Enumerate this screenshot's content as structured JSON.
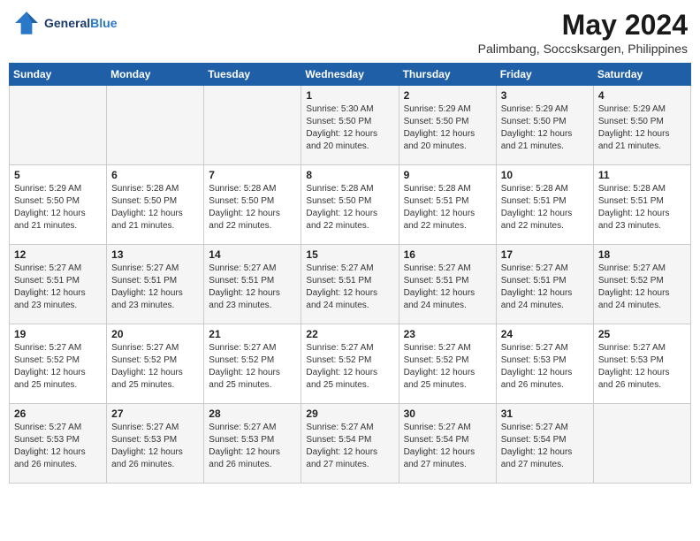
{
  "header": {
    "logo_line1": "General",
    "logo_line2": "Blue",
    "month_year": "May 2024",
    "location": "Palimbang, Soccsksargen, Philippines"
  },
  "days_of_week": [
    "Sunday",
    "Monday",
    "Tuesday",
    "Wednesday",
    "Thursday",
    "Friday",
    "Saturday"
  ],
  "weeks": [
    [
      {
        "day": "",
        "info": ""
      },
      {
        "day": "",
        "info": ""
      },
      {
        "day": "",
        "info": ""
      },
      {
        "day": "1",
        "info": "Sunrise: 5:30 AM\nSunset: 5:50 PM\nDaylight: 12 hours\nand 20 minutes."
      },
      {
        "day": "2",
        "info": "Sunrise: 5:29 AM\nSunset: 5:50 PM\nDaylight: 12 hours\nand 20 minutes."
      },
      {
        "day": "3",
        "info": "Sunrise: 5:29 AM\nSunset: 5:50 PM\nDaylight: 12 hours\nand 21 minutes."
      },
      {
        "day": "4",
        "info": "Sunrise: 5:29 AM\nSunset: 5:50 PM\nDaylight: 12 hours\nand 21 minutes."
      }
    ],
    [
      {
        "day": "5",
        "info": "Sunrise: 5:29 AM\nSunset: 5:50 PM\nDaylight: 12 hours\nand 21 minutes."
      },
      {
        "day": "6",
        "info": "Sunrise: 5:28 AM\nSunset: 5:50 PM\nDaylight: 12 hours\nand 21 minutes."
      },
      {
        "day": "7",
        "info": "Sunrise: 5:28 AM\nSunset: 5:50 PM\nDaylight: 12 hours\nand 22 minutes."
      },
      {
        "day": "8",
        "info": "Sunrise: 5:28 AM\nSunset: 5:50 PM\nDaylight: 12 hours\nand 22 minutes."
      },
      {
        "day": "9",
        "info": "Sunrise: 5:28 AM\nSunset: 5:51 PM\nDaylight: 12 hours\nand 22 minutes."
      },
      {
        "day": "10",
        "info": "Sunrise: 5:28 AM\nSunset: 5:51 PM\nDaylight: 12 hours\nand 22 minutes."
      },
      {
        "day": "11",
        "info": "Sunrise: 5:28 AM\nSunset: 5:51 PM\nDaylight: 12 hours\nand 23 minutes."
      }
    ],
    [
      {
        "day": "12",
        "info": "Sunrise: 5:27 AM\nSunset: 5:51 PM\nDaylight: 12 hours\nand 23 minutes."
      },
      {
        "day": "13",
        "info": "Sunrise: 5:27 AM\nSunset: 5:51 PM\nDaylight: 12 hours\nand 23 minutes."
      },
      {
        "day": "14",
        "info": "Sunrise: 5:27 AM\nSunset: 5:51 PM\nDaylight: 12 hours\nand 23 minutes."
      },
      {
        "day": "15",
        "info": "Sunrise: 5:27 AM\nSunset: 5:51 PM\nDaylight: 12 hours\nand 24 minutes."
      },
      {
        "day": "16",
        "info": "Sunrise: 5:27 AM\nSunset: 5:51 PM\nDaylight: 12 hours\nand 24 minutes."
      },
      {
        "day": "17",
        "info": "Sunrise: 5:27 AM\nSunset: 5:51 PM\nDaylight: 12 hours\nand 24 minutes."
      },
      {
        "day": "18",
        "info": "Sunrise: 5:27 AM\nSunset: 5:52 PM\nDaylight: 12 hours\nand 24 minutes."
      }
    ],
    [
      {
        "day": "19",
        "info": "Sunrise: 5:27 AM\nSunset: 5:52 PM\nDaylight: 12 hours\nand 25 minutes."
      },
      {
        "day": "20",
        "info": "Sunrise: 5:27 AM\nSunset: 5:52 PM\nDaylight: 12 hours\nand 25 minutes."
      },
      {
        "day": "21",
        "info": "Sunrise: 5:27 AM\nSunset: 5:52 PM\nDaylight: 12 hours\nand 25 minutes."
      },
      {
        "day": "22",
        "info": "Sunrise: 5:27 AM\nSunset: 5:52 PM\nDaylight: 12 hours\nand 25 minutes."
      },
      {
        "day": "23",
        "info": "Sunrise: 5:27 AM\nSunset: 5:52 PM\nDaylight: 12 hours\nand 25 minutes."
      },
      {
        "day": "24",
        "info": "Sunrise: 5:27 AM\nSunset: 5:53 PM\nDaylight: 12 hours\nand 26 minutes."
      },
      {
        "day": "25",
        "info": "Sunrise: 5:27 AM\nSunset: 5:53 PM\nDaylight: 12 hours\nand 26 minutes."
      }
    ],
    [
      {
        "day": "26",
        "info": "Sunrise: 5:27 AM\nSunset: 5:53 PM\nDaylight: 12 hours\nand 26 minutes."
      },
      {
        "day": "27",
        "info": "Sunrise: 5:27 AM\nSunset: 5:53 PM\nDaylight: 12 hours\nand 26 minutes."
      },
      {
        "day": "28",
        "info": "Sunrise: 5:27 AM\nSunset: 5:53 PM\nDaylight: 12 hours\nand 26 minutes."
      },
      {
        "day": "29",
        "info": "Sunrise: 5:27 AM\nSunset: 5:54 PM\nDaylight: 12 hours\nand 27 minutes."
      },
      {
        "day": "30",
        "info": "Sunrise: 5:27 AM\nSunset: 5:54 PM\nDaylight: 12 hours\nand 27 minutes."
      },
      {
        "day": "31",
        "info": "Sunrise: 5:27 AM\nSunset: 5:54 PM\nDaylight: 12 hours\nand 27 minutes."
      },
      {
        "day": "",
        "info": ""
      }
    ]
  ]
}
